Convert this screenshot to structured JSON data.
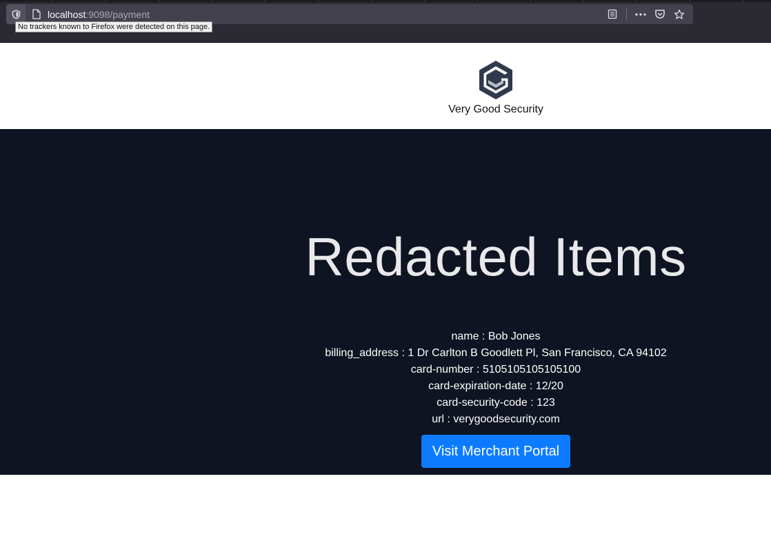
{
  "browser": {
    "url_host": "localhost",
    "url_path": ":9098/payment",
    "tooltip": "No trackers known to Firefox were detected on this page.",
    "icons": [
      "shield-icon",
      "page-icon",
      "reader-view-icon",
      "more-icon",
      "pocket-icon",
      "bookmark-star-icon"
    ]
  },
  "header": {
    "brand": "Very Good Security",
    "logo_color": "#2f3b4c"
  },
  "main": {
    "title": "Redacted Items",
    "fields": [
      {
        "label": "name",
        "value": "Bob Jones"
      },
      {
        "label": "billing_address",
        "value": "1 Dr Carlton B Goodlett Pl, San Francisco, CA 94102"
      },
      {
        "label": "card-number",
        "value": "5105105105105100"
      },
      {
        "label": "card-expiration-date",
        "value": "12/20"
      },
      {
        "label": "card-security-code",
        "value": "123"
      },
      {
        "label": "url",
        "value": "verygoodsecurity.com"
      }
    ],
    "button_label": "Visit Merchant Portal",
    "accent": "#0d7bff",
    "background": "#0e1421"
  }
}
